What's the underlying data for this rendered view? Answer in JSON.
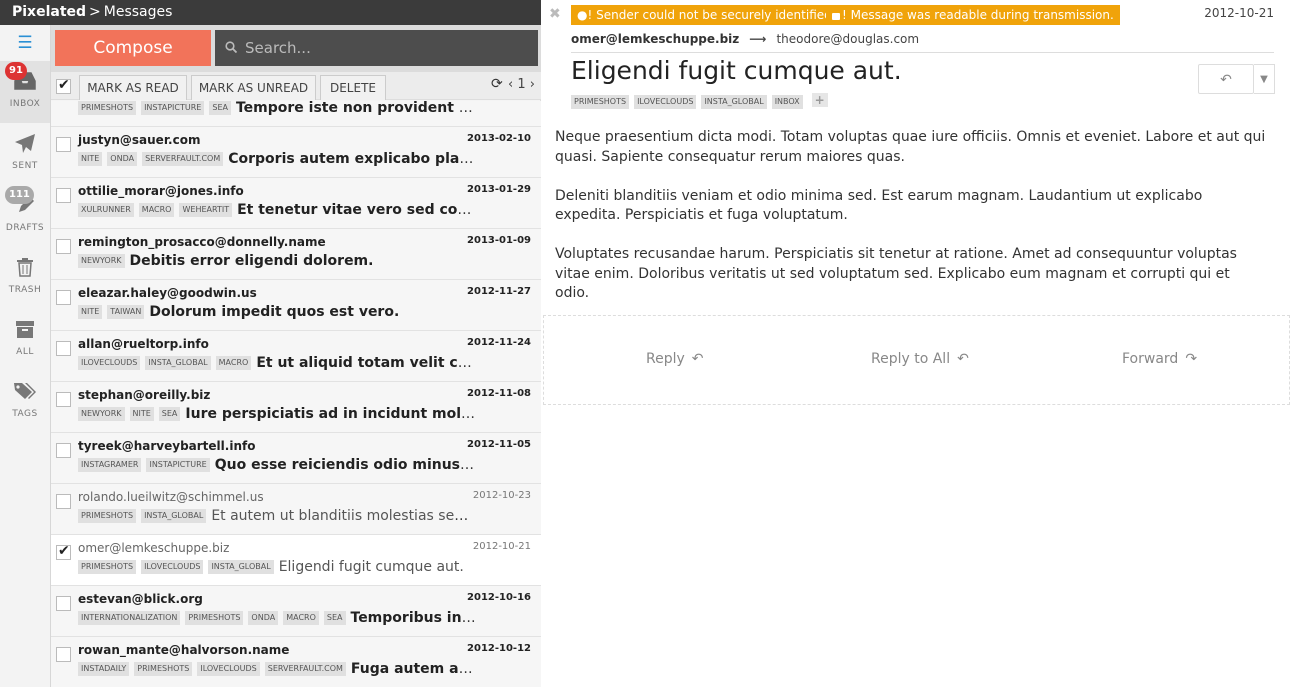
{
  "topbar": {
    "brand": "Pixelated",
    "separator": ">",
    "section": "Messages"
  },
  "nav": {
    "inbox": {
      "label": "INBOX",
      "badge": "91"
    },
    "sent": {
      "label": "SENT"
    },
    "drafts": {
      "label": "DRAFTS",
      "badge": "111"
    },
    "trash": {
      "label": "TRASH"
    },
    "all": {
      "label": "ALL"
    },
    "tags": {
      "label": "TAGS"
    }
  },
  "toolbar": {
    "compose_label": "Compose",
    "search_placeholder": "Search..."
  },
  "actions": {
    "mark_read": "MARK AS READ",
    "mark_unread": "MARK AS UNREAD",
    "delete": "DELETE",
    "page": "1"
  },
  "colors": {
    "compose": "#f2735a",
    "warning": "#f0a30a",
    "badge_red": "#d33333",
    "topbar": "#3b3b3b"
  },
  "messages": [
    {
      "from": "",
      "date": "",
      "tags": [
        "PRIMESHOTS",
        "INSTAPICTURE",
        "SEA"
      ],
      "subject": "Tempore iste non provident omnis",
      "read": false,
      "checked": false
    },
    {
      "from": "justyn@sauer.com",
      "date": "2013-02-10",
      "tags": [
        "NITE",
        "ONDA",
        "SERVERFAULT.COM"
      ],
      "subject": "Corporis autem explicabo placeat",
      "read": false,
      "checked": false
    },
    {
      "from": "ottilie_morar@jones.info",
      "date": "2013-01-29",
      "tags": [
        "XULRUNNER",
        "MACRO",
        "WEHEARTIT"
      ],
      "subject": "Et tenetur vitae vero sed corrupti",
      "read": false,
      "checked": false
    },
    {
      "from": "remington_prosacco@donnelly.name",
      "date": "2013-01-09",
      "tags": [
        "NEWYORK"
      ],
      "subject": "Debitis error eligendi dolorem.",
      "read": false,
      "checked": false
    },
    {
      "from": "eleazar.haley@goodwin.us",
      "date": "2012-11-27",
      "tags": [
        "NITE",
        "TAIWAN"
      ],
      "subject": "Dolorum impedit quos est vero.",
      "read": false,
      "checked": false
    },
    {
      "from": "allan@rueltorp.info",
      "date": "2012-11-24",
      "tags": [
        "ILOVECLOUDS",
        "INSTA_GLOBAL",
        "MACRO"
      ],
      "subject": "Et ut aliquid totam velit commodi",
      "read": false,
      "checked": false
    },
    {
      "from": "stephan@oreilly.biz",
      "date": "2012-11-08",
      "tags": [
        "NEWYORK",
        "NITE",
        "SEA"
      ],
      "subject": "Iure perspiciatis ad in incidunt molestias",
      "read": false,
      "checked": false
    },
    {
      "from": "tyreek@harveybartell.info",
      "date": "2012-11-05",
      "tags": [
        "INSTAGRAMER",
        "INSTAPICTURE"
      ],
      "subject": "Quo esse reiciendis odio minus repellat",
      "read": false,
      "checked": false
    },
    {
      "from": "rolando.lueilwitz@schimmel.us",
      "date": "2012-10-23",
      "tags": [
        "PRIMESHOTS",
        "INSTA_GLOBAL"
      ],
      "subject": "Et autem ut blanditiis molestias sed nam",
      "read": true,
      "checked": false
    },
    {
      "from": "omer@lemkeschuppe.biz",
      "date": "2012-10-21",
      "tags": [
        "PRIMESHOTS",
        "ILOVECLOUDS",
        "INSTA_GLOBAL"
      ],
      "subject": "Eligendi fugit cumque aut.",
      "read": true,
      "checked": true
    },
    {
      "from": "estevan@blick.org",
      "date": "2012-10-16",
      "tags": [
        "INTERNATIONALIZATION",
        "PRIMESHOTS",
        "ONDA",
        "MACRO",
        "SEA"
      ],
      "subject": "Temporibus in dolor",
      "read": false,
      "checked": false
    },
    {
      "from": "rowan_mante@halvorson.name",
      "date": "2012-10-12",
      "tags": [
        "INSTADAILY",
        "PRIMESHOTS",
        "ILOVECLOUDS",
        "SERVERFAULT.COM"
      ],
      "subject": "Fuga autem assumenda",
      "read": false,
      "checked": false
    }
  ],
  "reader": {
    "warning_sender": "Sender could not be securely identified.",
    "warning_transmission": "Message was readable during transmission.",
    "date": "2012-10-21",
    "from": "omer@lemkeschuppe.biz",
    "to": "theodore@douglas.com",
    "title": "Eligendi fugit cumque aut.",
    "tags": [
      "PRIMESHOTS",
      "ILOVECLOUDS",
      "INSTA_GLOBAL",
      "INBOX"
    ],
    "body": [
      "Neque praesentium dicta modi. Totam voluptas quae iure officiis. Omnis et eveniet. Labore et aut qui quasi. Sapiente consequatur rerum maiores quas.",
      "Deleniti blanditiis veniam et odio minima sed. Est earum magnam. Laudantium ut explicabo expedita. Perspiciatis et fuga voluptatum.",
      "Voluptates recusandae harum. Perspiciatis sit tenetur at ratione. Amet ad consequuntur voluptas vitae enim. Doloribus veritatis ut sed voluptatum sed. Explicabo eum magnam et corrupti qui et odio."
    ],
    "actions": {
      "reply": "Reply",
      "reply_all": "Reply to All",
      "forward": "Forward"
    }
  }
}
